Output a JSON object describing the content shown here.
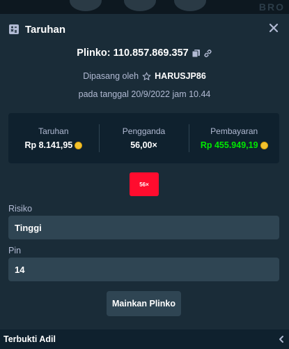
{
  "header": {
    "title": "Taruhan"
  },
  "bet": {
    "game_line": "Plinko: 110.857.869.357",
    "placed_by": "Dipasang oleh",
    "username": "HARUSJP86",
    "date": "pada tanggal 20/9/2022 jam 10.44"
  },
  "stats": [
    {
      "label": "Taruhan",
      "value": "Rp 8.141,95",
      "coin": true,
      "color": "#ffffff"
    },
    {
      "label": "Pengganda",
      "value": "56,00×",
      "coin": false,
      "color": "#ffffff"
    },
    {
      "label": "Pembayaran",
      "value": "Rp 455.949,19",
      "coin": true,
      "color": "#00e701"
    }
  ],
  "result": {
    "multiplier": "56×",
    "color": "#ff0c2e"
  },
  "form": {
    "risk_label": "Risiko",
    "risk_value": "Tinggi",
    "pins_label": "Pin",
    "pins_value": "14"
  },
  "play_button": "Mainkan Plinko",
  "footer": {
    "label": "Terbukti Adil"
  },
  "colors": {
    "bg": "#1a2c38",
    "panel": "#0f212e",
    "input": "#2f4553",
    "muted": "#b1bad3",
    "win": "#00e701",
    "chip": "#ff0c2e"
  }
}
